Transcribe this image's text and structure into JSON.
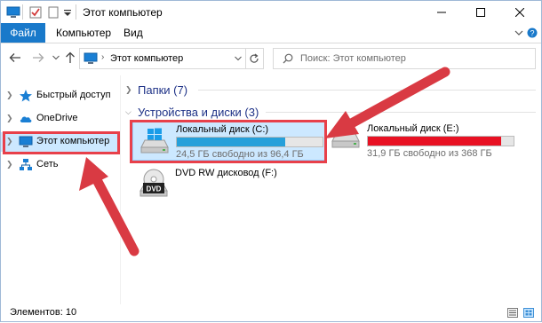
{
  "window": {
    "title": "Этот компьютер",
    "controls": {
      "minimize": "minimize-icon",
      "maximize": "maximize-icon",
      "close": "close-icon"
    }
  },
  "ribbon": {
    "tabs": [
      "Файл",
      "Компьютер",
      "Вид"
    ],
    "file_color": "#1979ca"
  },
  "address": {
    "path_label": "Этот компьютер",
    "search_placeholder": "Поиск: Этот компьютер"
  },
  "nav_pane": {
    "items": [
      {
        "label": "Быстрый доступ",
        "icon": "star-icon"
      },
      {
        "label": "OneDrive",
        "icon": "cloud-icon"
      },
      {
        "label": "Этот компьютер",
        "icon": "computer-icon",
        "selected": true
      },
      {
        "label": "Сеть",
        "icon": "network-icon"
      }
    ]
  },
  "content": {
    "folders_group": "Папки (7)",
    "devices_group": "Устройства и диски (3)",
    "drives": [
      {
        "name": "Локальный диск (C:)",
        "free": "24,5 ГБ свободно из 96,4 ГБ",
        "used_fraction": 0.746,
        "bar_color": "#26a0da",
        "icon": "windows-drive-icon",
        "selected": true
      },
      {
        "name": "Локальный диск (E:)",
        "free": "31,9 ГБ свободно из 368 ГБ",
        "used_fraction": 0.913,
        "bar_color": "#e81123",
        "icon": "hard-drive-icon"
      },
      {
        "name": "DVD RW дисковод (F:)",
        "icon": "dvd-drive-icon",
        "badge": "DVD"
      }
    ]
  },
  "status": {
    "items": "Элементов: 10"
  },
  "accent": {
    "highlight": "#e8404a",
    "group_heading": "#1e3287",
    "selection": "#cce8ff"
  }
}
